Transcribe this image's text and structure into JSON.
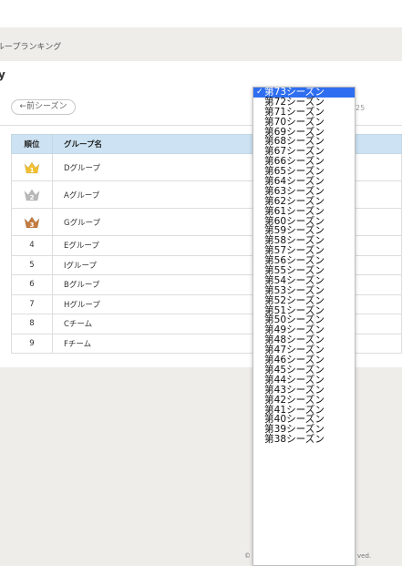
{
  "breadcrumb": "ループランキング",
  "page_title": "y",
  "prev_button": "←前シーズン",
  "page_number": "25",
  "table": {
    "headers": {
      "rank": "順位",
      "group": "グループ名"
    },
    "rows": [
      {
        "rank": "1",
        "name": "Dグループ",
        "medal": "gold"
      },
      {
        "rank": "2",
        "name": "Aグループ",
        "medal": "silver"
      },
      {
        "rank": "3",
        "name": "Gグループ",
        "medal": "bronze"
      },
      {
        "rank": "4",
        "name": "Eグループ"
      },
      {
        "rank": "5",
        "name": "Iグループ"
      },
      {
        "rank": "6",
        "name": "Bグループ"
      },
      {
        "rank": "7",
        "name": "Hグループ"
      },
      {
        "rank": "8",
        "name": "Cチーム"
      },
      {
        "rank": "9",
        "name": "Fチーム"
      }
    ]
  },
  "season_dropdown": {
    "selected": "第73シーズン",
    "options": [
      "第73シーズン",
      "第72シーズン",
      "第71シーズン",
      "第70シーズン",
      "第69シーズン",
      "第68シーズン",
      "第67シーズン",
      "第66シーズン",
      "第65シーズン",
      "第64シーズン",
      "第63シーズン",
      "第62シーズン",
      "第61シーズン",
      "第60シーズン",
      "第59シーズン",
      "第58シーズン",
      "第57シーズン",
      "第56シーズン",
      "第55シーズン",
      "第54シーズン",
      "第53シーズン",
      "第52シーズン",
      "第51シーズン",
      "第50シーズン",
      "第49シーズン",
      "第48シーズン",
      "第47シーズン",
      "第46シーズン",
      "第45シーズン",
      "第44シーズン",
      "第43シーズン",
      "第42シーズン",
      "第41シーズン",
      "第40シーズン",
      "第39シーズン",
      "第38シーズン"
    ]
  },
  "footer": {
    "left": "©",
    "right": "ved."
  },
  "colors": {
    "header_bg": "#cde3f3",
    "selected": "#2f6ef0",
    "gold": "#f2c030",
    "silver": "#b9b9b9",
    "bronze": "#c37b3e"
  }
}
